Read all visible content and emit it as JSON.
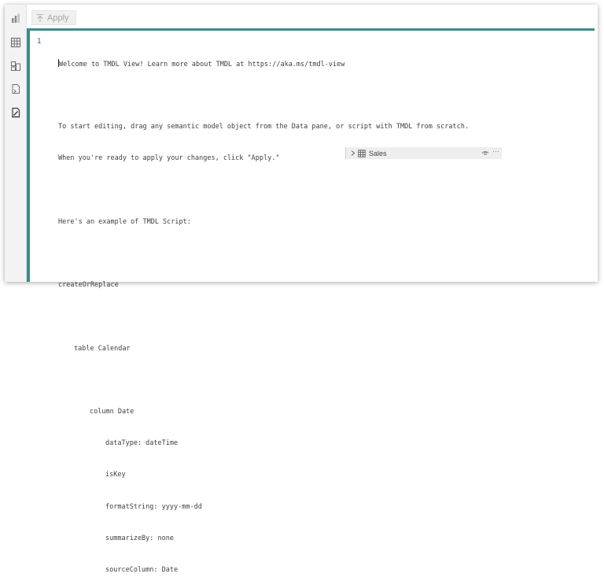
{
  "toolbar": {
    "apply_label": "Apply"
  },
  "sidebar": {
    "icons": [
      "report-view-icon",
      "table-view-icon",
      "model-view-icon",
      "dax-query-view-icon",
      "tmdl-view-icon"
    ]
  },
  "editor": {
    "line_number": "1",
    "lines": [
      "Welcome to TMDL View! Learn more about TMDL at https://aka.ms/tmdl-view",
      "",
      "To start editing, drag any semantic model object from the Data pane, or script with TMDL from scratch.",
      "When you're ready to apply your changes, click \"Apply.\"",
      "",
      "Here's an example of TMDL Script:",
      "",
      "createOrReplace",
      "",
      "table Calendar",
      "",
      "column Date",
      "dataType: dateTime",
      "isKey",
      "formatString: yyyy-mm-dd",
      "summarizeBy: none",
      "sourceColumn: Date"
    ]
  },
  "peek_node": {
    "label": "Sales",
    "more_label": "···"
  }
}
